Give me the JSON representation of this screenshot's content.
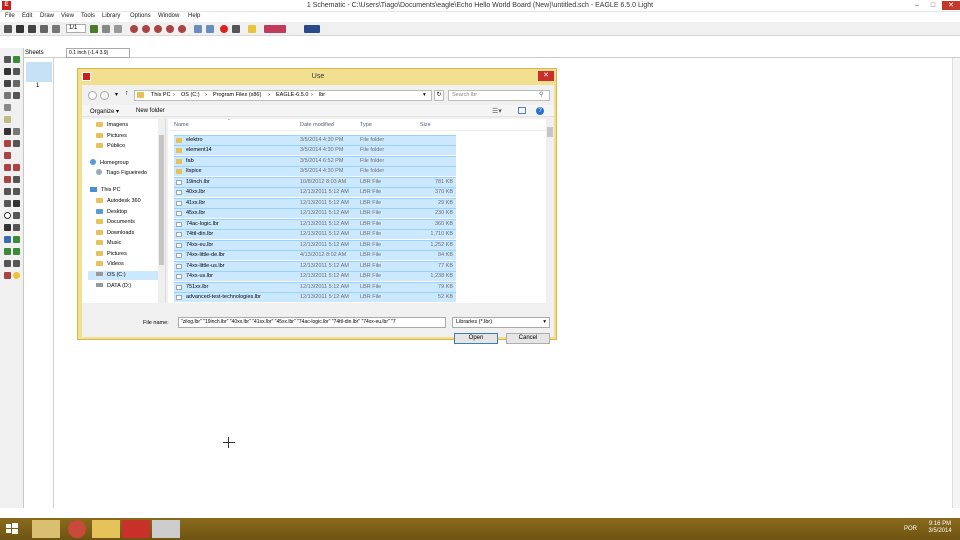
{
  "window": {
    "title": "1 Schematic - C:\\Users\\Tiago\\Documents\\eagle\\Echo Hello World Board (New)\\untitled.sch - EAGLE 6.5.0 Light",
    "minimize": "–",
    "maximize": "□",
    "close": "✕"
  },
  "menu": [
    "File",
    "Edit",
    "Draw",
    "View",
    "Tools",
    "Library",
    "Options",
    "Window",
    "Help"
  ],
  "toolbar": {
    "sheet_select": "1/1"
  },
  "coords": {
    "sheets_label": "Sheets",
    "coordinate": "0.1 inch (-1.4 3.9)"
  },
  "sheets_panel": {
    "sheet_number": "1"
  },
  "dialog": {
    "title": "Use",
    "close": "✕",
    "breadcrumb": [
      "This PC",
      "OS (C:)",
      "Program Files (x86)",
      "EAGLE-6.5.0",
      "lbr"
    ],
    "search_placeholder": "Search lbr",
    "organize": "Organize ▾",
    "new_folder": "New folder",
    "nav_items": [
      {
        "label": "Imagens",
        "kind": "folder"
      },
      {
        "label": "Pictures",
        "kind": "folder"
      },
      {
        "label": "Público",
        "kind": "folder"
      },
      {
        "label": "Homegroup",
        "kind": "group"
      },
      {
        "label": "Tiago Figueiredo",
        "kind": "user"
      },
      {
        "label": "This PC",
        "kind": "pc"
      },
      {
        "label": "Autodesk 360",
        "kind": "folder"
      },
      {
        "label": "Desktop",
        "kind": "folder"
      },
      {
        "label": "Documents",
        "kind": "folder"
      },
      {
        "label": "Downloads",
        "kind": "folder"
      },
      {
        "label": "Music",
        "kind": "folder"
      },
      {
        "label": "Pictures",
        "kind": "folder"
      },
      {
        "label": "Videos",
        "kind": "folder"
      },
      {
        "label": "OS (C:)",
        "kind": "drive"
      },
      {
        "label": "DATA (D:)",
        "kind": "drive"
      }
    ],
    "columns": {
      "name": "Name",
      "date": "Date modified",
      "type": "Type",
      "size": "Size"
    },
    "files": [
      {
        "name": "elektro",
        "date": "3/5/2014 4:30 PM",
        "type": "File folder",
        "size": ""
      },
      {
        "name": "element14",
        "date": "3/5/2014 4:30 PM",
        "type": "File folder",
        "size": ""
      },
      {
        "name": "fab",
        "date": "3/5/2014 6:52 PM",
        "type": "File folder",
        "size": ""
      },
      {
        "name": "ltspice",
        "date": "3/5/2014 4:30 PM",
        "type": "File folder",
        "size": ""
      },
      {
        "name": "19inch.lbr",
        "date": "10/8/2012 8:03 AM",
        "type": "LBR File",
        "size": "781 KB"
      },
      {
        "name": "40xx.lbr",
        "date": "12/13/2011 5:12 AM",
        "type": "LBR File",
        "size": "370 KB"
      },
      {
        "name": "41xx.lbr",
        "date": "12/13/2011 5:12 AM",
        "type": "LBR File",
        "size": "29 KB"
      },
      {
        "name": "45xx.lbr",
        "date": "12/13/2011 5:12 AM",
        "type": "LBR File",
        "size": "230 KB"
      },
      {
        "name": "74ac-logic.lbr",
        "date": "12/13/2011 5:12 AM",
        "type": "LBR File",
        "size": "360 KB"
      },
      {
        "name": "74ttl-din.lbr",
        "date": "12/13/2011 5:12 AM",
        "type": "LBR File",
        "size": "1,710 KB"
      },
      {
        "name": "74xx-eu.lbr",
        "date": "12/13/2011 5:12 AM",
        "type": "LBR File",
        "size": "1,252 KB"
      },
      {
        "name": "74xx-little-de.lbr",
        "date": "4/13/2012 8:02 AM",
        "type": "LBR File",
        "size": "84 KB"
      },
      {
        "name": "74xx-little-us.lbr",
        "date": "12/13/2011 5:12 AM",
        "type": "LBR File",
        "size": "77 KB"
      },
      {
        "name": "74xx-us.lbr",
        "date": "12/13/2011 5:12 AM",
        "type": "LBR File",
        "size": "1,238 KB"
      },
      {
        "name": "751xx.lbr",
        "date": "12/13/2011 5:12 AM",
        "type": "LBR File",
        "size": "79 KB"
      },
      {
        "name": "advanced-test-technologies.lbr",
        "date": "12/13/2011 5:12 AM",
        "type": "LBR File",
        "size": "52 KB"
      }
    ],
    "file_name_label": "File name:",
    "file_name_value": "\"zilog.lbr\" \"19inch.lbr\" \"40xx.lbr\" \"41xx.lbr\" \"45xx.lbr\" \"74ac-logic.lbr\" \"74ttl-din.lbr\" \"74xx-eu.lbr\" \"7",
    "filter": "Libraries (*.lbr)",
    "open": "Open",
    "cancel": "Cancel"
  },
  "taskbar": {
    "time": "9:16 PM",
    "date": "3/5/2014",
    "lang": "POR"
  },
  "colors": {
    "dialog_frame": "#f2df8f",
    "selection": "#cce8ff",
    "taskbar": "#7a5e17"
  }
}
